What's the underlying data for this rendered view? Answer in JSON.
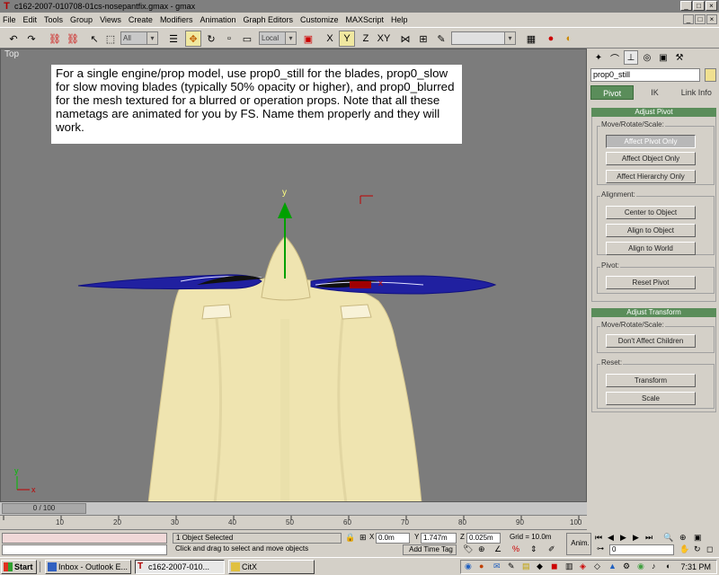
{
  "window": {
    "title": "c162-2007-010708-01cs-nosepantfix.gmax - gmax"
  },
  "menu": [
    "File",
    "Edit",
    "Tools",
    "Group",
    "Views",
    "Create",
    "Modifiers",
    "Animation",
    "Graph Editors",
    "Customize",
    "MAXScript",
    "Help"
  ],
  "toolbar": {
    "filter_select": "All",
    "coord_select": "Local",
    "named_selection": ""
  },
  "viewport": {
    "label": "Top",
    "note": "For a single engine/prop model, use prop0_still for the blades, prop0_slow for slow moving blades (typically 50% opacity or higher), and prop0_blurred for the mesh textured for a blurred or operation props.  Note that all these nametags are animated for you by FS.  Name them properly and they will work.",
    "axis_y": "y",
    "axis_x": "x",
    "axis_y_small": "y",
    "axis_x_small": "x"
  },
  "command_panel": {
    "object_name": "prop0_still",
    "tabs": [
      "Pivot",
      "IK",
      "Link Info"
    ],
    "adjust_pivot": {
      "title": "Adjust Pivot",
      "move_group": "Move/Rotate/Scale:",
      "buttons": [
        "Affect Pivot Only",
        "Affect Object Only",
        "Affect Hierarchy Only"
      ],
      "alignment_group": "Alignment:",
      "align_buttons": [
        "Center to Object",
        "Align to Object",
        "Align to World"
      ],
      "pivot_group": "Pivot:",
      "reset_pivot": "Reset Pivot"
    },
    "adjust_transform": {
      "title": "Adjust Transform",
      "move_group": "Move/Rotate/Scale:",
      "dont_affect": "Don't Affect Children",
      "reset_group": "Reset:",
      "transform": "Transform",
      "scale": "Scale"
    }
  },
  "timeline": {
    "slider": "0 / 100",
    "ticks": [
      "10",
      "20",
      "30",
      "40",
      "50",
      "60",
      "70",
      "80",
      "90",
      "100"
    ]
  },
  "status": {
    "selected": "1 Object Selected",
    "prompt": "Click and drag to select and move objects",
    "x_label": "X",
    "x_value": "0.0m",
    "y_label": "Y",
    "y_value": "1.747m",
    "z_label": "Z",
    "z_value": "0.025m",
    "grid": "Grid = 10.0m",
    "add_time_tag": "Add Time Tag",
    "anim": "Anim.",
    "frame": "0"
  },
  "taskbar": {
    "start": "Start",
    "tasks": [
      "Inbox - Outlook E...",
      "c162-2007-010...",
      "CitX"
    ],
    "clock": "7:31 PM"
  },
  "colors": {
    "titlebar": "#7f7f7f",
    "viewport_bg": "#7c7c7c",
    "panel_green": "#5a8d5a",
    "fuselage": "#efe4b0",
    "prop_blue": "#2020a0"
  }
}
